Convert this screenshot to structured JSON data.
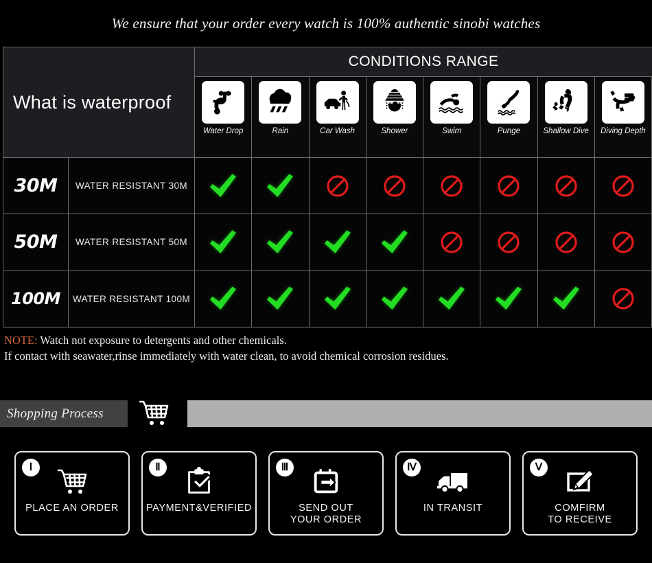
{
  "banner": {
    "text": "We ensure that your order every watch is 100% authentic sinobi watches"
  },
  "waterproof_table": {
    "title": "What is waterproof",
    "conditions_header": "CONDITIONS RANGE",
    "columns": [
      {
        "label": "Water Drop",
        "icon": "water-drop-icon"
      },
      {
        "label": "Rain",
        "icon": "rain-icon"
      },
      {
        "label": "Car Wash",
        "icon": "car-wash-icon"
      },
      {
        "label": "Shower",
        "icon": "shower-icon"
      },
      {
        "label": "Swim",
        "icon": "swim-icon"
      },
      {
        "label": "Punge",
        "icon": "punge-icon"
      },
      {
        "label": "Shallow\nDive",
        "icon": "shallow-dive-icon"
      },
      {
        "label": "Diving\nDepth",
        "icon": "diving-depth-icon"
      }
    ],
    "rows": [
      {
        "depth": "30M",
        "resistance": "WATER RESISTANT  30M",
        "marks": [
          "yes",
          "yes",
          "no",
          "no",
          "no",
          "no",
          "no",
          "no"
        ]
      },
      {
        "depth": "50M",
        "resistance": "WATER RESISTANT 50M",
        "marks": [
          "yes",
          "yes",
          "yes",
          "yes",
          "no",
          "no",
          "no",
          "no"
        ]
      },
      {
        "depth": "100M",
        "resistance": "WATER RESISTANT  100M",
        "marks": [
          "yes",
          "yes",
          "yes",
          "yes",
          "yes",
          "yes",
          "yes",
          "no"
        ]
      }
    ],
    "mark_colors": {
      "yes": "#22dd22",
      "no": "#e01b1b"
    }
  },
  "note": {
    "label": "NOTE:",
    "line1": " Watch not exposure to detergents and other chemicals.",
    "line2": "If contact with seawater,rinse immediately with water clean, to avoid chemical corrosion residues.",
    "label_color": "#d2683a"
  },
  "shopping_process": {
    "title": "Shopping Process",
    "cart_icon": "shopping-cart-icon",
    "bar_color": "#b0b0b0",
    "title_bg_color": "#414141"
  },
  "steps": [
    {
      "numeral": "Ⅰ",
      "label": "PLACE AN ORDER",
      "icon": "shopping-cart-icon"
    },
    {
      "numeral": "Ⅱ",
      "label": "PAYMENT&VERIFIED",
      "icon": "clipboard-check-icon"
    },
    {
      "numeral": "Ⅲ",
      "label": "SEND OUT\nYOUR ORDER",
      "icon": "calendar-arrow-icon"
    },
    {
      "numeral": "Ⅳ",
      "label": "IN TRANSIT",
      "icon": "delivery-truck-icon"
    },
    {
      "numeral": "Ⅴ",
      "label": "COMFIRM\nTO RECEIVE",
      "icon": "edit-pencil-icon"
    }
  ]
}
